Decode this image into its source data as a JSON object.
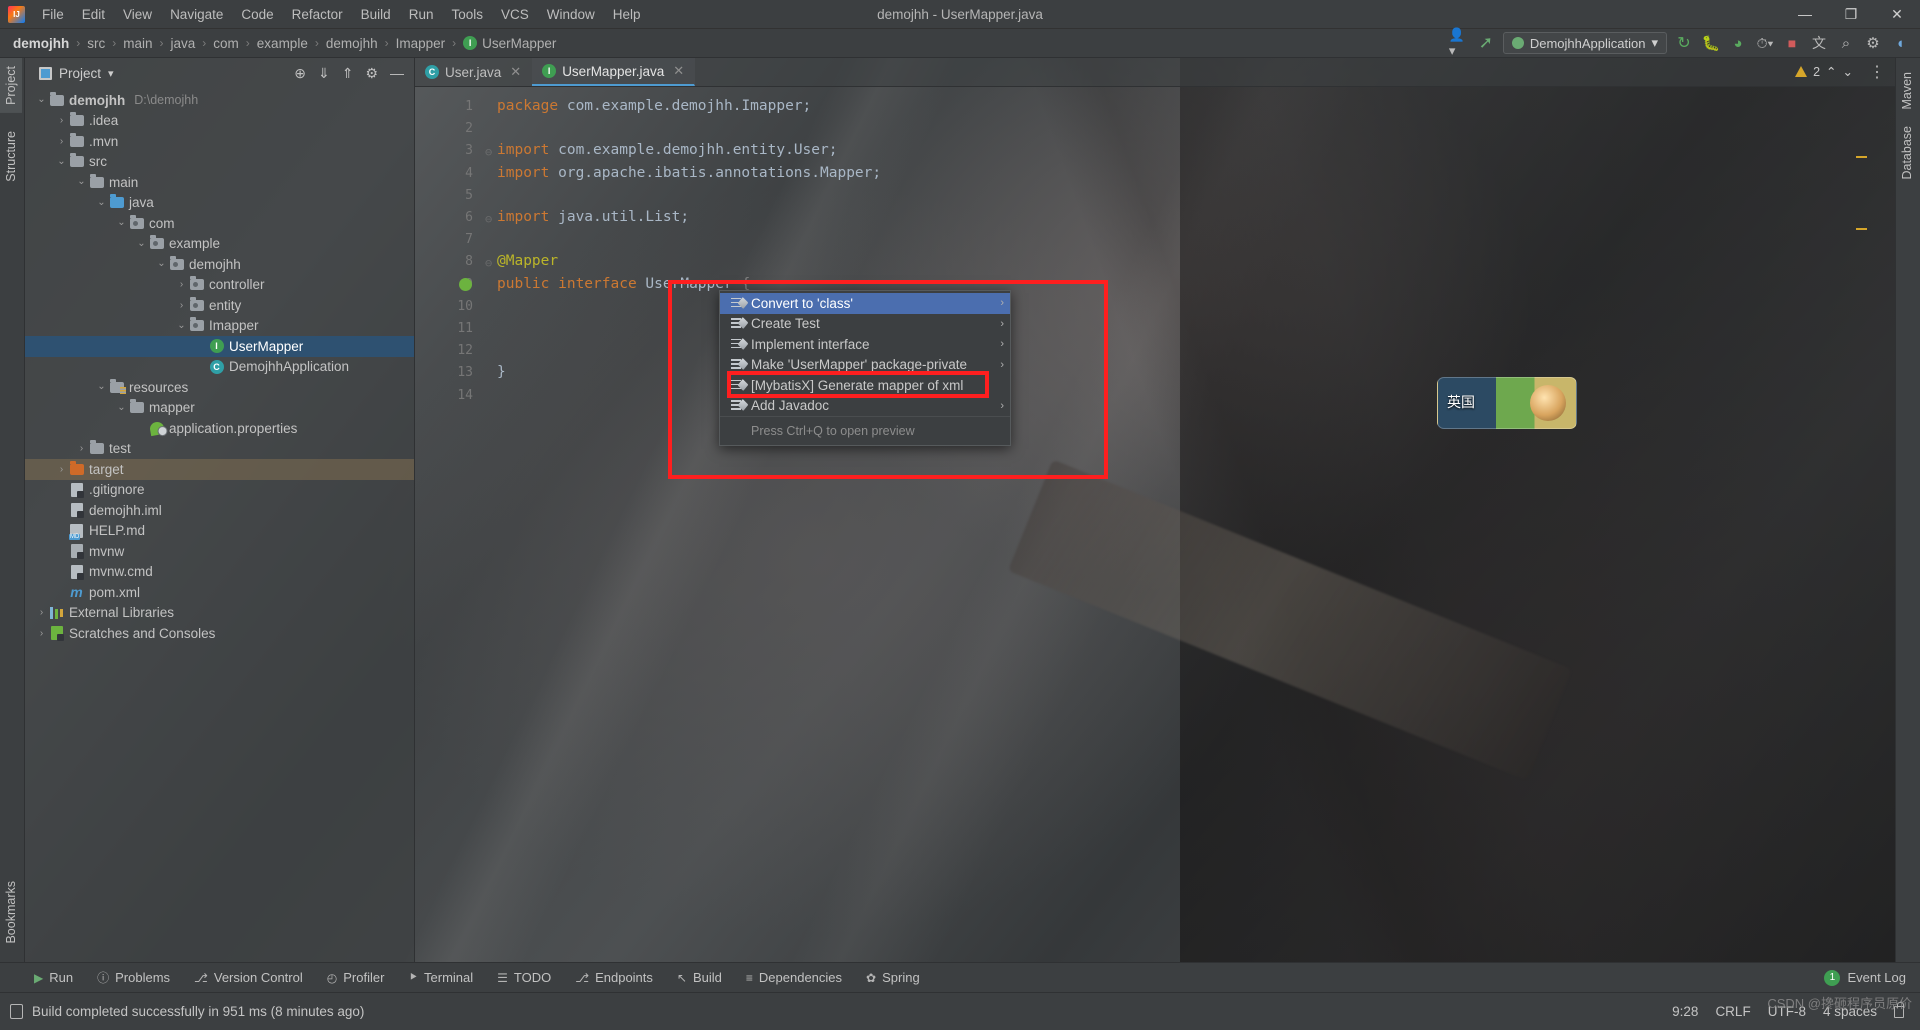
{
  "window": {
    "title": "demojhh - UserMapper.java",
    "app_logo": "intellij-idea-logo",
    "minimize": "—",
    "maximize": "❐",
    "close": "✕"
  },
  "menubar": {
    "items": [
      {
        "label": "File"
      },
      {
        "label": "Edit"
      },
      {
        "label": "View"
      },
      {
        "label": "Navigate"
      },
      {
        "label": "Code"
      },
      {
        "label": "Refactor"
      },
      {
        "label": "Build"
      },
      {
        "label": "Run"
      },
      {
        "label": "Tools"
      },
      {
        "label": "VCS"
      },
      {
        "label": "Window"
      },
      {
        "label": "Help"
      }
    ]
  },
  "navbar": {
    "breadcrumbs": [
      {
        "label": "demojhh"
      },
      {
        "label": "src"
      },
      {
        "label": "main"
      },
      {
        "label": "java"
      },
      {
        "label": "com"
      },
      {
        "label": "example"
      },
      {
        "label": "demojhh"
      },
      {
        "label": "Imapper"
      },
      {
        "label": "UserMapper",
        "icon": "interface-icon",
        "icon_letter": "I"
      }
    ],
    "separator": "›",
    "run_config": "DemojhhApplication",
    "run_config_caret": "▾",
    "icons": [
      {
        "name": "account-icon",
        "glyph": "὆4"
      },
      {
        "name": "hammer-build-icon",
        "glyph": "↖"
      },
      {
        "name": "rerun-icon",
        "glyph": "↻"
      },
      {
        "name": "debug-icon",
        "glyph": "☲"
      },
      {
        "name": "run-with-coverage-icon",
        "glyph": "◑"
      },
      {
        "name": "profiler-icon",
        "glyph": "◴"
      },
      {
        "name": "stop-icon",
        "glyph": "■"
      },
      {
        "name": "translate-icon",
        "glyph": "文"
      },
      {
        "name": "search-everywhere-icon",
        "glyph": "⌕"
      },
      {
        "name": "settings-gear-icon",
        "glyph": "⚙"
      },
      {
        "name": "ide-assistant-icon",
        "glyph": "◖"
      }
    ]
  },
  "left_strip": {
    "tabs": [
      {
        "label": "Project",
        "active": true
      },
      {
        "label": "Structure",
        "active": false
      },
      {
        "label": "Bookmarks",
        "active": false
      }
    ]
  },
  "right_strip": {
    "tabs": [
      {
        "label": "Maven"
      },
      {
        "label": "Database"
      }
    ]
  },
  "project_panel": {
    "title": "Project",
    "title_caret": "▾",
    "actions": [
      {
        "name": "select-opened-file-icon",
        "glyph": "⊕"
      },
      {
        "name": "expand-all-icon",
        "glyph": "⤓"
      },
      {
        "name": "collapse-all-icon",
        "glyph": "⤒"
      },
      {
        "name": "settings-icon",
        "glyph": "⚙"
      },
      {
        "name": "hide-icon",
        "glyph": "—"
      }
    ],
    "tree": [
      {
        "label": "demojhh",
        "suffix": "D:\\demojhh",
        "depth": 0,
        "arrow": "v",
        "icon": "module-folder",
        "bold": true
      },
      {
        "label": ".idea",
        "depth": 1,
        "arrow": ">",
        "icon": "folder"
      },
      {
        "label": ".mvn",
        "depth": 1,
        "arrow": ">",
        "icon": "folder"
      },
      {
        "label": "src",
        "depth": 1,
        "arrow": "v",
        "icon": "folder"
      },
      {
        "label": "main",
        "depth": 2,
        "arrow": "v",
        "icon": "folder"
      },
      {
        "label": "java",
        "depth": 3,
        "arrow": "v",
        "icon": "source-folder"
      },
      {
        "label": "com",
        "depth": 4,
        "arrow": "v",
        "icon": "package"
      },
      {
        "label": "example",
        "depth": 5,
        "arrow": "v",
        "icon": "package"
      },
      {
        "label": "demojhh",
        "depth": 6,
        "arrow": "v",
        "icon": "package"
      },
      {
        "label": "controller",
        "depth": 7,
        "arrow": ">",
        "icon": "package"
      },
      {
        "label": "entity",
        "depth": 7,
        "arrow": ">",
        "icon": "package"
      },
      {
        "label": "Imapper",
        "depth": 7,
        "arrow": "v",
        "icon": "package"
      },
      {
        "label": "UserMapper",
        "depth": 8,
        "arrow": "",
        "icon": "interface",
        "selected": true
      },
      {
        "label": "DemojhhApplication",
        "depth": 8,
        "arrow": "",
        "icon": "spring-class"
      },
      {
        "label": "resources",
        "depth": 3,
        "arrow": "v",
        "icon": "resource-folder"
      },
      {
        "label": "mapper",
        "depth": 4,
        "arrow": "v",
        "icon": "folder"
      },
      {
        "label": "application.properties",
        "depth": 5,
        "arrow": "",
        "icon": "spring-properties"
      },
      {
        "label": "test",
        "depth": 2,
        "arrow": ">",
        "icon": "folder"
      },
      {
        "label": "target",
        "depth": 1,
        "arrow": ">",
        "icon": "excluded-folder",
        "marked": true
      },
      {
        "label": ".gitignore",
        "depth": 1,
        "arrow": "",
        "icon": "gitignore-file"
      },
      {
        "label": "demojhh.iml",
        "depth": 1,
        "arrow": "",
        "icon": "iml-file"
      },
      {
        "label": "HELP.md",
        "depth": 1,
        "arrow": "",
        "icon": "markdown-file"
      },
      {
        "label": "mvnw",
        "depth": 1,
        "arrow": "",
        "icon": "shell-file"
      },
      {
        "label": "mvnw.cmd",
        "depth": 1,
        "arrow": "",
        "icon": "cmd-file"
      },
      {
        "label": "pom.xml",
        "depth": 1,
        "arrow": "",
        "icon": "maven-file"
      },
      {
        "label": "External Libraries",
        "depth": 0,
        "arrow": ">",
        "icon": "libraries"
      },
      {
        "label": "Scratches and Consoles",
        "depth": 0,
        "arrow": ">",
        "icon": "scratches"
      }
    ]
  },
  "editor": {
    "tabs": [
      {
        "label": "User.java",
        "icon_letter": "C",
        "active": false,
        "close": "✕"
      },
      {
        "label": "UserMapper.java",
        "icon_letter": "I",
        "active": true,
        "close": "✕"
      }
    ],
    "tab_menu_icon": "⋮",
    "inspection_count": "2",
    "inspection_caret_up": "⌃",
    "inspection_caret_down": "⌄",
    "line_numbers": [
      "1",
      "2",
      "3",
      "4",
      "5",
      "6",
      "7",
      "8",
      "9",
      "10",
      "11",
      "12",
      "13",
      "14"
    ],
    "lines": [
      {
        "n": 1,
        "tokens": [
          {
            "t": "package ",
            "c": "kw"
          },
          {
            "t": "com.example.demojhh.Imapper;",
            "c": "plain"
          }
        ]
      },
      {
        "n": 2,
        "tokens": []
      },
      {
        "n": 3,
        "tokens": [
          {
            "t": "import ",
            "c": "kw"
          },
          {
            "t": "com.example.demojhh.entity.",
            "c": "plain"
          },
          {
            "t": "User",
            "c": "cls"
          },
          {
            "t": ";",
            "c": "plain"
          }
        ]
      },
      {
        "n": 4,
        "tokens": [
          {
            "t": "import ",
            "c": "kw"
          },
          {
            "t": "org.apache.ibatis.annotations.",
            "c": "plain"
          },
          {
            "t": "Mapper",
            "c": "cls"
          },
          {
            "t": ";",
            "c": "plain"
          }
        ]
      },
      {
        "n": 5,
        "tokens": []
      },
      {
        "n": 6,
        "tokens": [
          {
            "t": "import ",
            "c": "kw"
          },
          {
            "t": "java.util.List;",
            "c": "plain"
          }
        ]
      },
      {
        "n": 7,
        "tokens": []
      },
      {
        "n": 8,
        "tokens": [
          {
            "t": "@Mapper",
            "c": "ann"
          }
        ]
      },
      {
        "n": 9,
        "tokens": [
          {
            "t": "public ",
            "c": "kw"
          },
          {
            "t": "interface ",
            "c": "kw"
          },
          {
            "t": "UserMapper ",
            "c": "cls"
          },
          {
            "t": "{",
            "c": "fold-bracket"
          }
        ]
      },
      {
        "n": 10,
        "tokens": []
      },
      {
        "n": 11,
        "tokens": []
      },
      {
        "n": 12,
        "tokens": []
      },
      {
        "n": 13,
        "tokens": [
          {
            "t": "}",
            "c": "plain"
          }
        ]
      },
      {
        "n": 14,
        "tokens": []
      }
    ]
  },
  "context_menu": {
    "items": [
      {
        "label": "Convert to 'class'",
        "icon": "generate-icon",
        "submenu": "›",
        "highlighted": true
      },
      {
        "label": "Create Test",
        "icon": "generate-icon",
        "submenu": "›"
      },
      {
        "label": "Implement interface",
        "icon": "generate-icon",
        "submenu": "›"
      },
      {
        "label": "Make 'UserMapper' package-private",
        "icon": "generate-icon",
        "submenu": "›"
      },
      {
        "label": "[MybatisX] Generate mapper of xml",
        "icon": "generate-icon",
        "submenu": "",
        "annotated": true
      },
      {
        "label": "Add Javadoc",
        "icon": "generate-icon",
        "submenu": "›"
      }
    ],
    "hint": "Press Ctrl+Q to open preview"
  },
  "float_widget": {
    "text": "英国"
  },
  "bottom_tabs": {
    "items": [
      {
        "label": "Run",
        "icon": "run-icon",
        "glyph": "▶"
      },
      {
        "label": "Problems",
        "icon": "problems-icon",
        "glyph": "ⓘ"
      },
      {
        "label": "Version Control",
        "icon": "vcs-icon",
        "glyph": "⎇"
      },
      {
        "label": "Profiler",
        "icon": "profiler-icon",
        "glyph": "◴"
      },
      {
        "label": "Terminal",
        "icon": "terminal-icon",
        "glyph": "⯈"
      },
      {
        "label": "TODO",
        "icon": "todo-icon",
        "glyph": "☰"
      },
      {
        "label": "Endpoints",
        "icon": "endpoints-icon",
        "glyph": "⎇"
      },
      {
        "label": "Build",
        "icon": "build-icon",
        "glyph": "↖"
      },
      {
        "label": "Dependencies",
        "icon": "dependencies-icon",
        "glyph": "≡"
      },
      {
        "label": "Spring",
        "icon": "spring-icon",
        "glyph": "✿"
      }
    ],
    "event_log": {
      "label": "Event Log",
      "count": "1"
    }
  },
  "status_bar": {
    "message": "Build completed successfully in 951 ms (8 minutes ago)",
    "time": "9:28",
    "line_separator": "CRLF",
    "encoding": "UTF-8",
    "indent": "4 spaces",
    "lock_icon": "read-only-lock-icon"
  },
  "watermark": {
    "text": "CSDN @搀砸程序员原价"
  },
  "colors": {
    "accent_blue": "#4b6eaf",
    "selection_blue": "#2e5171",
    "annotation_red": "#fe1f1f",
    "panel_bg": "#3c3f41",
    "green": "#3f9e52",
    "orange": "#cf6a28",
    "keyword": "#cc7832",
    "annotation_yellow": "#bbb529"
  }
}
